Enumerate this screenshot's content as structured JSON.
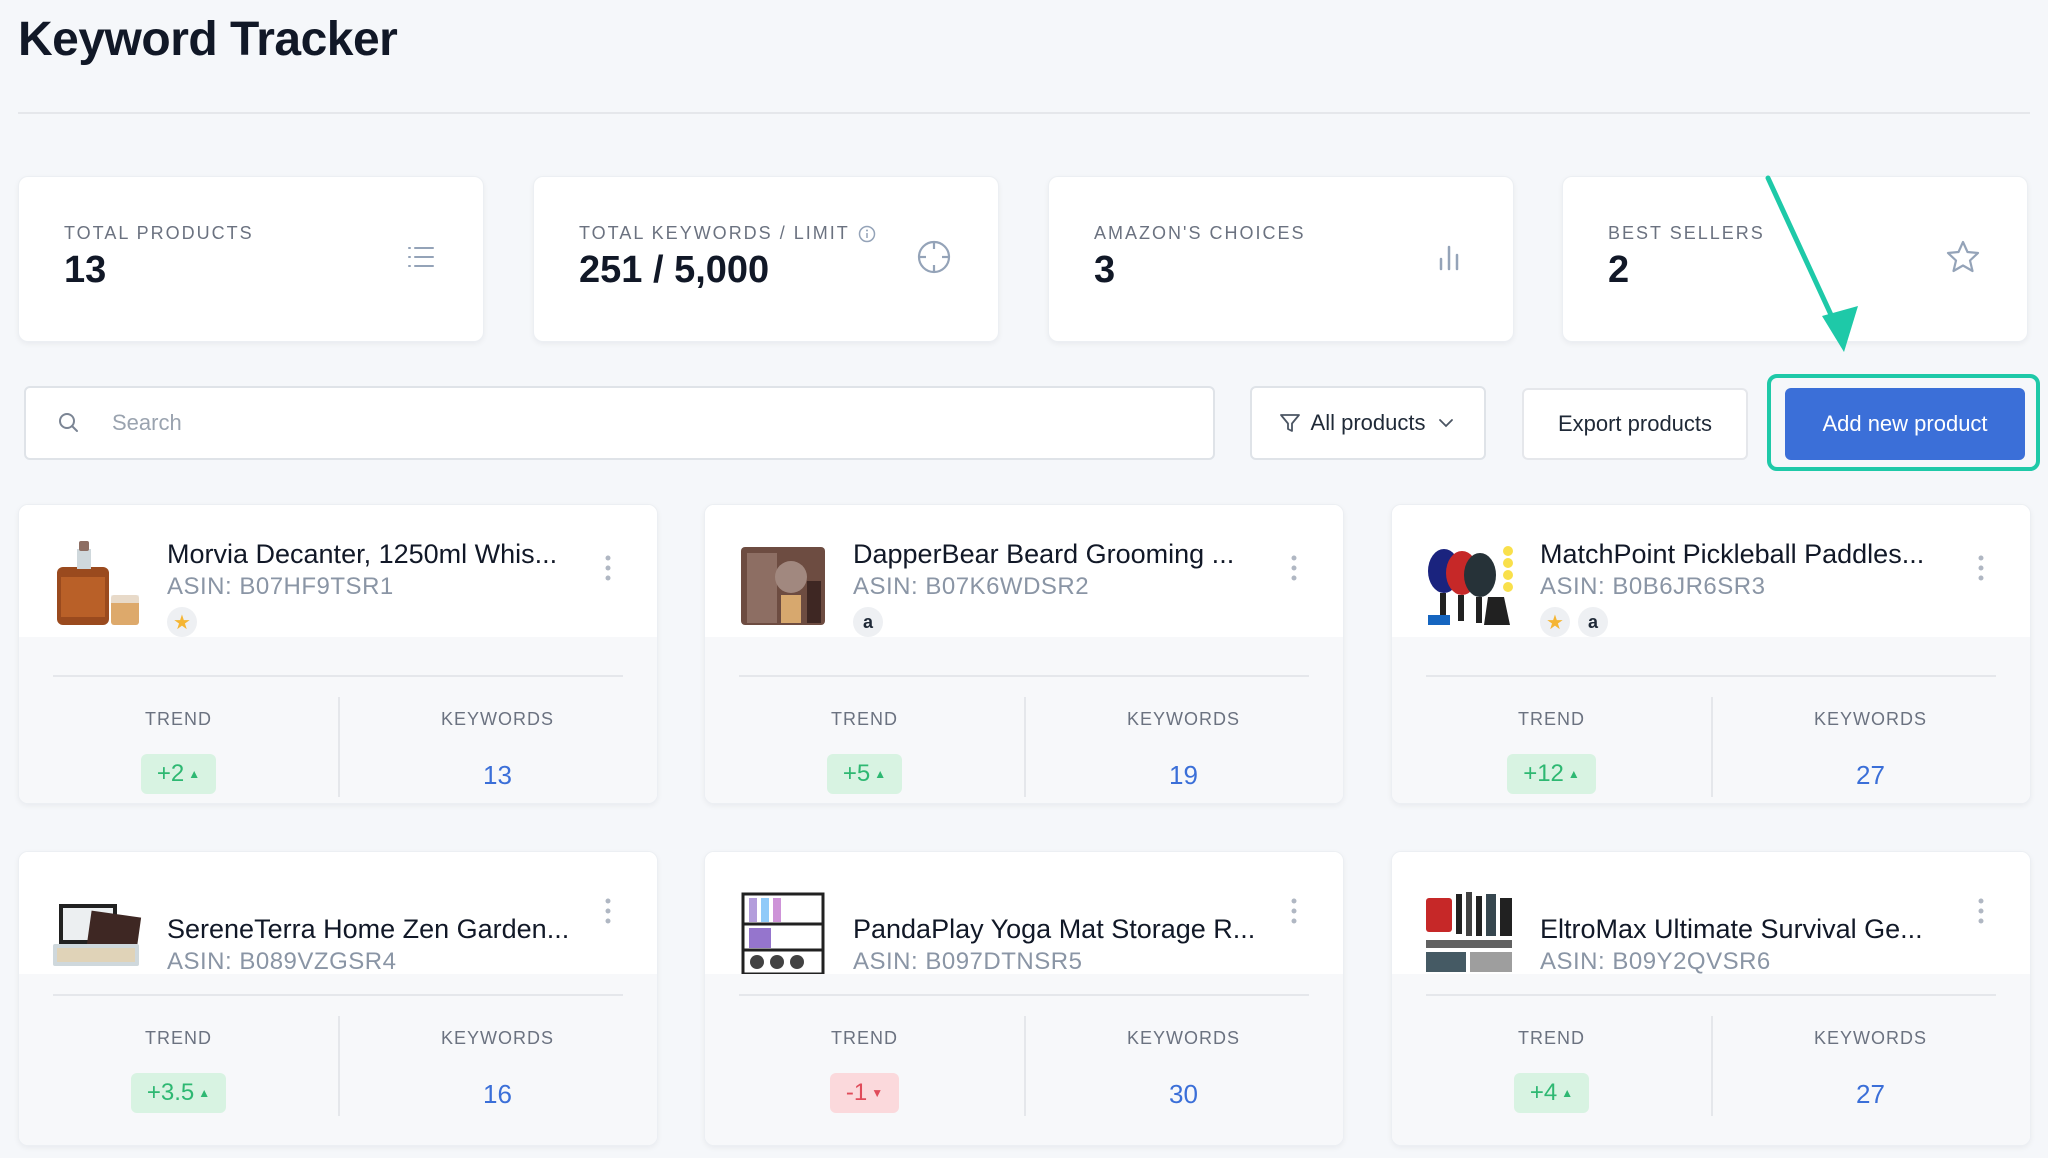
{
  "page": {
    "title": "Keyword Tracker"
  },
  "stats": [
    {
      "label": "TOTAL PRODUCTS",
      "value": "13",
      "icon": "list-icon"
    },
    {
      "label": "TOTAL KEYWORDS / LIMIT",
      "value": "251 / 5,000",
      "icon": "crosshair-icon"
    },
    {
      "label": "AMAZON'S CHOICES",
      "value": "3",
      "icon": "bar-chart-icon"
    },
    {
      "label": "BEST SELLERS",
      "value": "2",
      "icon": "star-icon"
    }
  ],
  "toolbar": {
    "search_placeholder": "Search",
    "search_value": "",
    "filter_label": "All products",
    "export_label": "Export products",
    "add_label": "Add new product"
  },
  "colors": {
    "accent": "#3b6fd8",
    "highlight": "#1ec9a8",
    "trend_up": "#2eb872",
    "trend_down": "#e04b5a"
  },
  "labels": {
    "trend": "TREND",
    "keywords": "KEYWORDS"
  },
  "products": [
    {
      "title": "Morvia Decanter, 1250ml Whis...",
      "asin": "ASIN: B07HF9TSR1",
      "badges": [
        "star"
      ],
      "trend": "+2",
      "trend_dir": "up",
      "keywords": "13"
    },
    {
      "title": "DapperBear Beard Grooming ...",
      "asin": "ASIN: B07K6WDSR2",
      "badges": [
        "amazon"
      ],
      "trend": "+5",
      "trend_dir": "up",
      "keywords": "19"
    },
    {
      "title": "MatchPoint Pickleball Paddles...",
      "asin": "ASIN: B0B6JR6SR3",
      "badges": [
        "star",
        "amazon"
      ],
      "trend": "+12",
      "trend_dir": "up",
      "keywords": "27"
    },
    {
      "title": "SereneTerra Home Zen Garden...",
      "asin": "ASIN: B089VZGSR4",
      "badges": [],
      "trend": "+3.5",
      "trend_dir": "up",
      "keywords": "16"
    },
    {
      "title": "PandaPlay Yoga Mat Storage R...",
      "asin": "ASIN: B097DTNSR5",
      "badges": [],
      "trend": "-1",
      "trend_dir": "down",
      "keywords": "30"
    },
    {
      "title": "EltroMax Ultimate Survival Ge...",
      "asin": "ASIN: B09Y2QVSR6",
      "badges": [],
      "trend": "+4",
      "trend_dir": "up",
      "keywords": "27"
    }
  ]
}
